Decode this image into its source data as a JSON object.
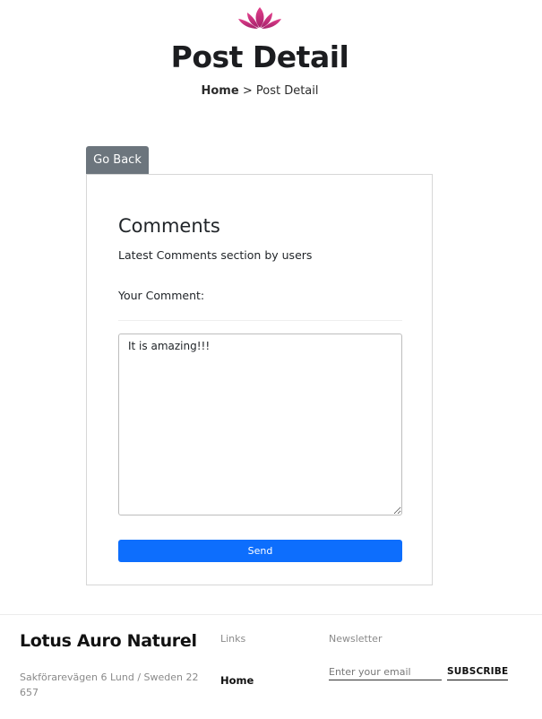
{
  "header": {
    "logo_icon": "lotus-icon",
    "title": "Post Detail",
    "breadcrumb": {
      "home": "Home",
      "separator": ">",
      "current": "Post Detail"
    }
  },
  "actions": {
    "go_back_label": "Go Back"
  },
  "comments": {
    "title": "Comments",
    "subtitle": "Latest Comments section by users",
    "your_comment_label": "Your Comment:",
    "textarea_value": "It is amazing!!!",
    "send_label": "Send"
  },
  "footer": {
    "brand": "Lotus Auro Naturel",
    "address": "Sakförarevägen 6 Lund / Sweden 22 657",
    "links_heading": "Links",
    "links": [
      "Home"
    ],
    "newsletter_heading": "Newsletter",
    "email_placeholder": "Enter your email",
    "subscribe_label": "SUBSCRIBE"
  },
  "colors": {
    "logo": "#d1307b",
    "go_back_button": "#6c757d",
    "send_button": "#0d6efd"
  }
}
